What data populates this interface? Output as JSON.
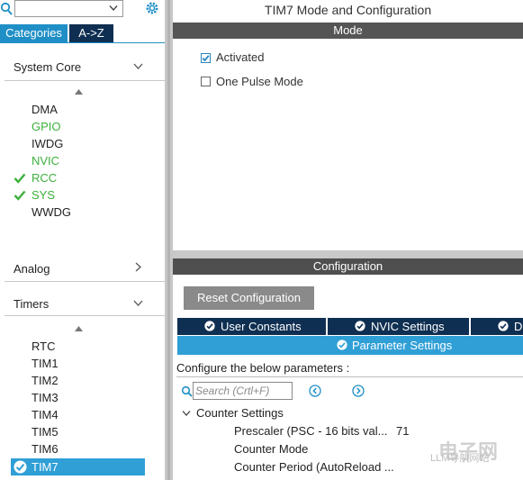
{
  "left_panel": {
    "tabs": {
      "categories": "Categories",
      "az": "A->Z"
    },
    "sections": [
      {
        "label": "System Core",
        "expanded": true
      },
      {
        "label": "Analog",
        "expanded": false
      },
      {
        "label": "Timers",
        "expanded": true
      }
    ],
    "system_core_items": [
      {
        "label": "DMA",
        "status": "none"
      },
      {
        "label": "GPIO",
        "status": "configured"
      },
      {
        "label": "IWDG",
        "status": "none"
      },
      {
        "label": "NVIC",
        "status": "configured"
      },
      {
        "label": "RCC",
        "status": "ok"
      },
      {
        "label": "SYS",
        "status": "ok"
      },
      {
        "label": "WWDG",
        "status": "none"
      }
    ],
    "timers_items": [
      {
        "label": "RTC"
      },
      {
        "label": "TIM1"
      },
      {
        "label": "TIM2"
      },
      {
        "label": "TIM3"
      },
      {
        "label": "TIM4"
      },
      {
        "label": "TIM5"
      },
      {
        "label": "TIM6"
      },
      {
        "label": "TIM7",
        "selected": true
      }
    ]
  },
  "right_panel": {
    "title": "TIM7 Mode and Configuration",
    "mode_header": "Mode",
    "mode_options": [
      {
        "label": "Activated",
        "checked": true
      },
      {
        "label": "One Pulse Mode",
        "checked": false
      }
    ],
    "config_header": "Configuration",
    "reset_button": "Reset Configuration",
    "config_tabs": [
      {
        "label": "User Constants"
      },
      {
        "label": "NVIC Settings"
      },
      {
        "label": "D"
      }
    ],
    "active_tab": "Parameter Settings",
    "hint": "Configure the below parameters :",
    "search_placeholder": "Search (Crtl+F)",
    "group": "Counter Settings",
    "params": [
      {
        "name": "Prescaler (PSC - 16 bits val...",
        "value": "71"
      },
      {
        "name": "Counter Mode",
        "value": ""
      },
      {
        "name": "Counter Period (AutoReload ...",
        "value": ""
      }
    ]
  },
  "watermark": {
    "brand": "电子网",
    "caption": "LLM导航网站"
  },
  "colors": {
    "accent": "#2f9fd6",
    "navy": "#0f2f52",
    "green": "#3cb03c",
    "header_gray": "#555555"
  }
}
